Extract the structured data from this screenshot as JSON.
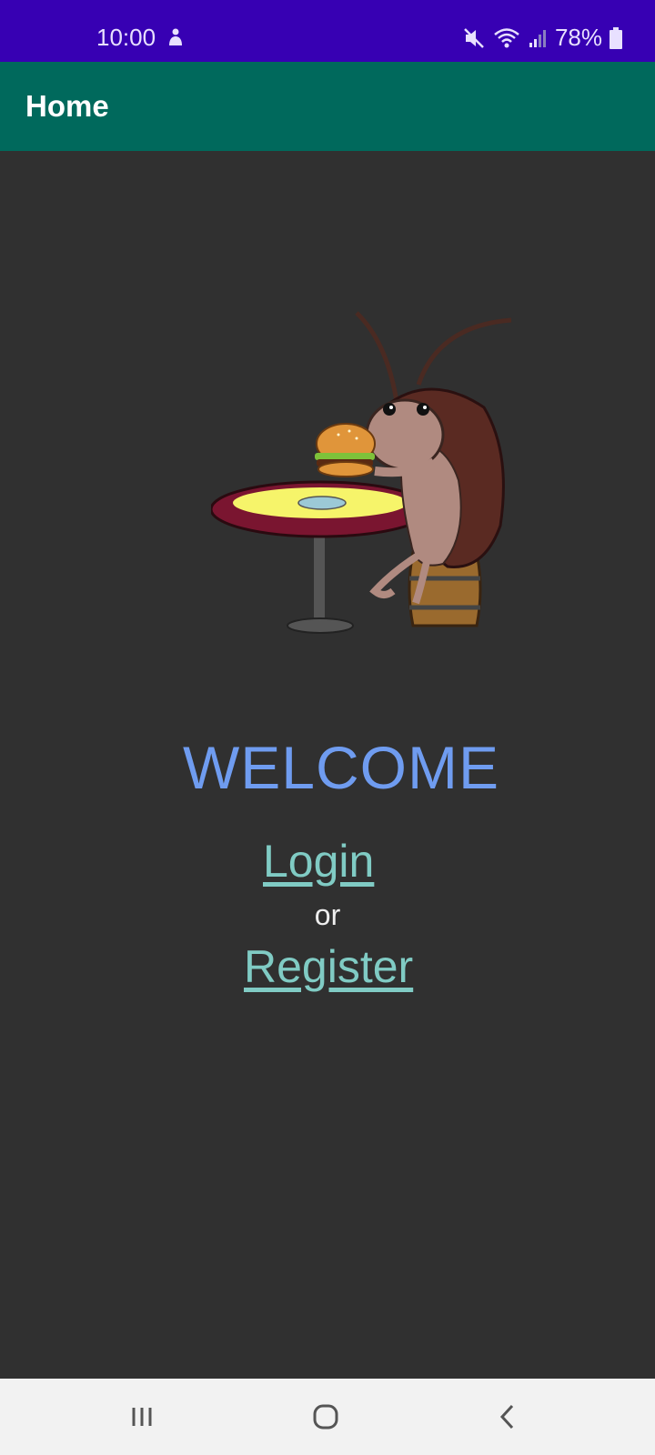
{
  "status_bar": {
    "time": "10:00",
    "battery": "78%",
    "icons": [
      "person-icon",
      "mute-icon",
      "wifi-icon",
      "signal-icon",
      "battery-icon"
    ]
  },
  "app_bar": {
    "title": "Home"
  },
  "main": {
    "illustration": "cockroach-eating-burger-illustration",
    "welcome": "WELCOME",
    "login_label": "Login",
    "or_label": "or",
    "register_label": "Register"
  },
  "nav_bar": {
    "icons": [
      "recents-icon",
      "home-icon",
      "back-icon"
    ]
  },
  "colors": {
    "status_bar": "#3700b3",
    "app_bar": "#00695c",
    "background": "#303030",
    "welcome": "#6f9cf0",
    "link": "#80cbc4"
  }
}
